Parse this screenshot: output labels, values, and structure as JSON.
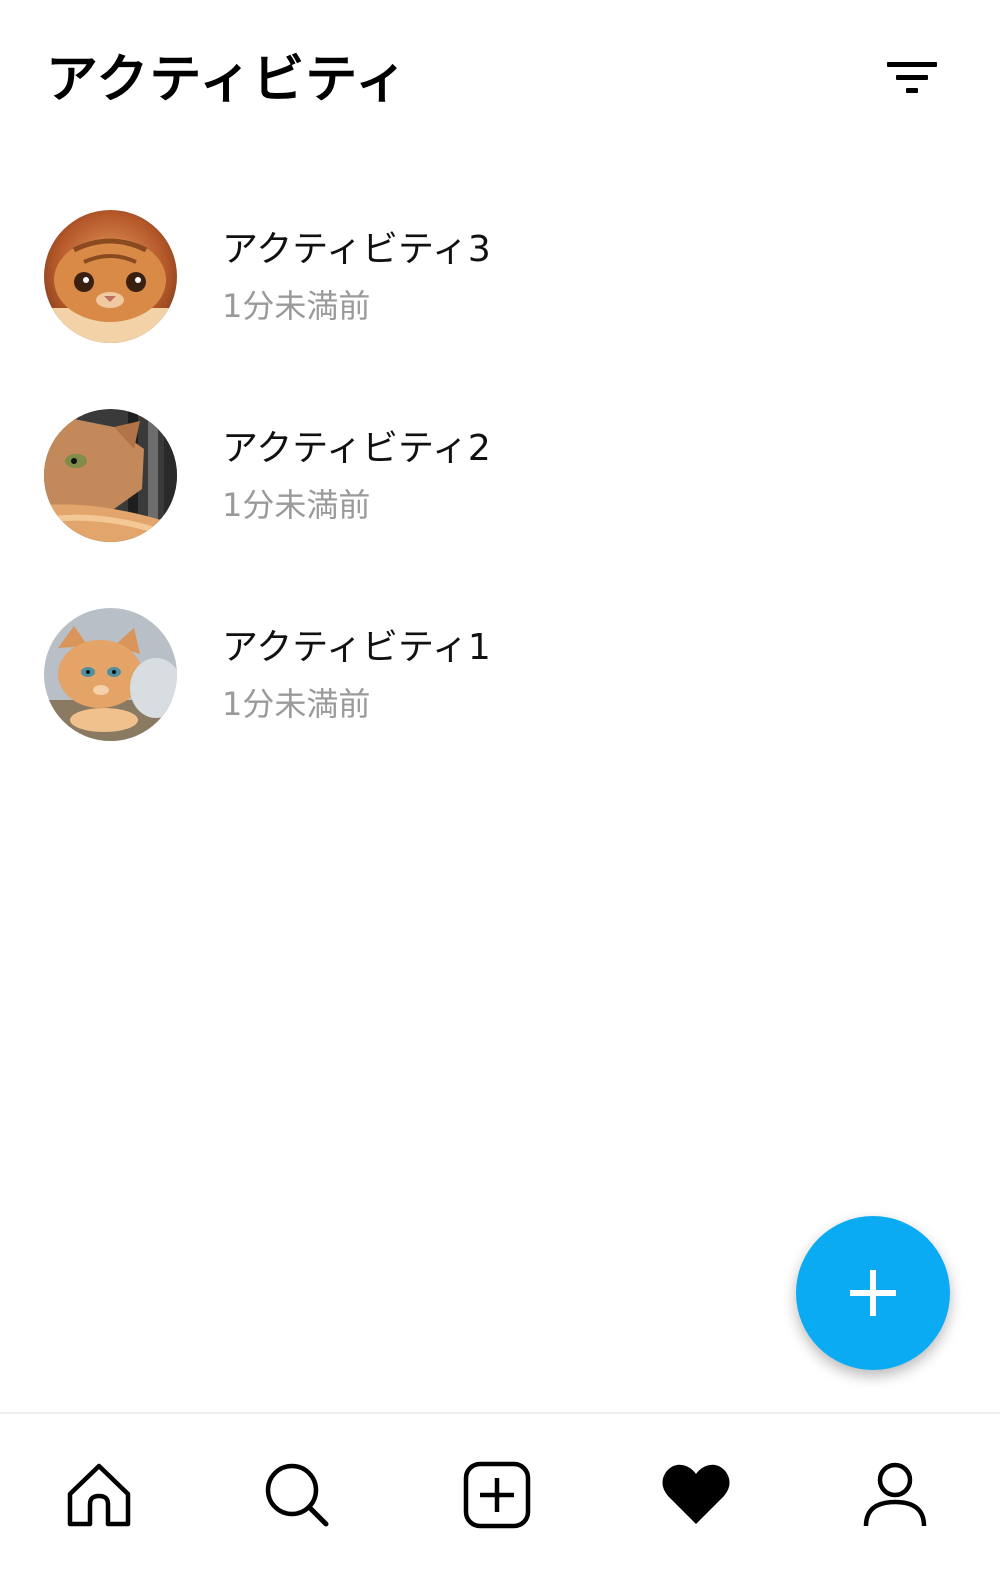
{
  "header": {
    "title": "アクティビティ",
    "filter_icon": "filter-list-icon"
  },
  "activities": [
    {
      "title": "アクティビティ3",
      "time": "1分未満前",
      "avatar": "cat-photo-avatar"
    },
    {
      "title": "アクティビティ2",
      "time": "1分未満前",
      "avatar": "cat-photo-avatar"
    },
    {
      "title": "アクティビティ1",
      "time": "1分未満前",
      "avatar": "cat-photo-avatar"
    }
  ],
  "fab": {
    "icon": "plus-icon",
    "color": "#0aabf3"
  },
  "bottom_nav": {
    "items": [
      {
        "icon": "home-icon",
        "active": false
      },
      {
        "icon": "search-icon",
        "active": false
      },
      {
        "icon": "add-square-icon",
        "active": false
      },
      {
        "icon": "heart-icon",
        "active": true
      },
      {
        "icon": "profile-icon",
        "active": false
      }
    ]
  },
  "colors": {
    "accent": "#0aabf3",
    "secondary_text": "#9a9a9a",
    "primary_text": "#000000"
  }
}
